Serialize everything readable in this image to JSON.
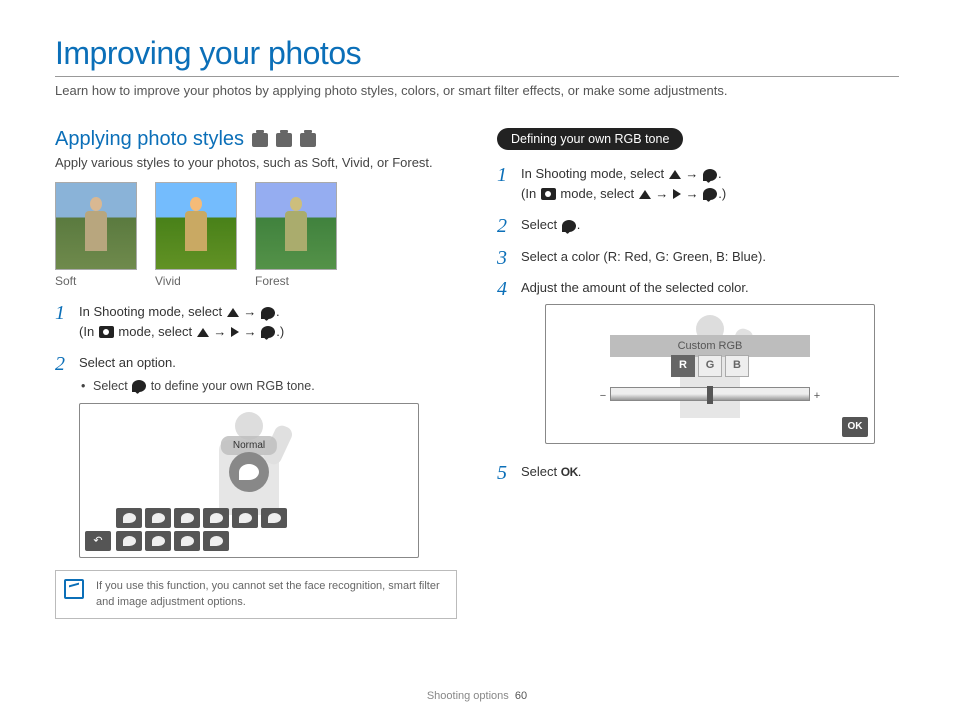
{
  "title": "Improving your photos",
  "subtitle": "Learn how to improve your photos by applying photo styles, colors, or smart filter effects, or make some adjustments.",
  "left": {
    "heading": "Applying photo styles",
    "desc": "Apply various styles to your photos, such as Soft, Vivid, or Forest.",
    "thumbs": {
      "soft": "Soft",
      "vivid": "Vivid",
      "forest": "Forest"
    },
    "step1a": "In Shooting mode, select ",
    "step1b": "(In ",
    "step1c": " mode, select ",
    "step2": "Select an option.",
    "bullet": "Select ",
    "bullet_after": " to define your own RGB tone.",
    "normal_label": "Normal",
    "note": "If you use this function, you cannot set the face recognition, smart filter and image adjustment options."
  },
  "right": {
    "pill": "Defining your own RGB tone",
    "step1a": "In Shooting mode, select ",
    "step1b": "(In ",
    "step1c": " mode, select ",
    "step2": "Select ",
    "step3": "Select a color (R: Red, G: Green, B: Blue).",
    "step4": "Adjust the amount of the selected color.",
    "rgb_header": "Custom RGB",
    "rgb_r": "R",
    "rgb_g": "G",
    "rgb_b": "B",
    "ok": "OK",
    "step5a": "Select ",
    "step5b": "."
  },
  "footer": {
    "section": "Shooting options",
    "page": "60"
  }
}
